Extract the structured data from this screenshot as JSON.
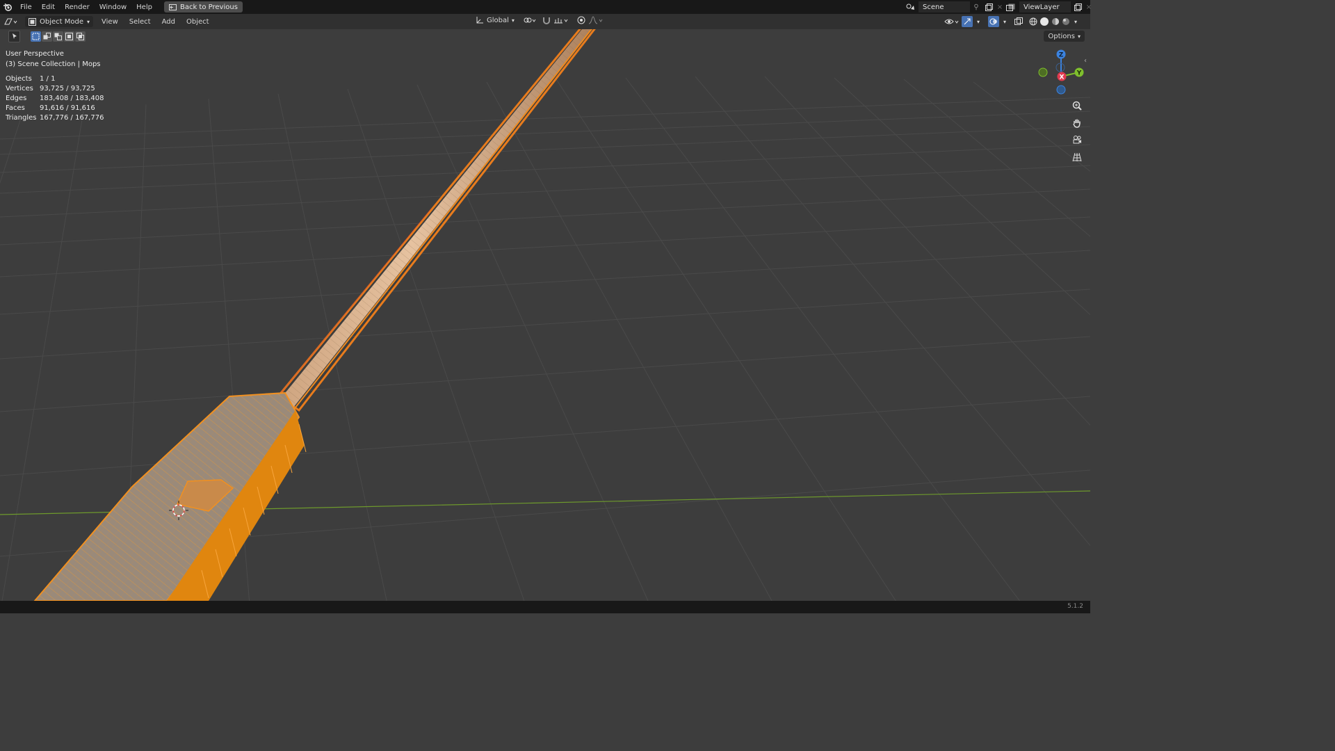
{
  "menu": {
    "file": "File",
    "edit": "Edit",
    "render": "Render",
    "window": "Window",
    "help": "Help",
    "back_to_previous": "Back to Previous"
  },
  "scene": {
    "name": "Scene"
  },
  "view_layer": {
    "name": "ViewLayer"
  },
  "viewport_header": {
    "mode": "Object Mode",
    "view": "View",
    "select": "Select",
    "add": "Add",
    "object": "Object",
    "orientation": "Global"
  },
  "options_label": "Options",
  "overlay": {
    "perspective": "User Perspective",
    "collection": "(3) Scene Collection | Mops"
  },
  "stats": [
    {
      "label": "Objects",
      "value": "1 / 1"
    },
    {
      "label": "Vertices",
      "value": "93,725 / 93,725"
    },
    {
      "label": "Edges",
      "value": "183,408 / 183,408"
    },
    {
      "label": "Faces",
      "value": "91,616 / 91,616"
    },
    {
      "label": "Triangles",
      "value": "167,776 / 167,776"
    }
  ],
  "gizmo": {
    "z": "Z",
    "x": "X",
    "y": "Y"
  },
  "version": "5.1.2",
  "colors": {
    "selection_orange": "#f2901f",
    "axis_x": "#e13a4f",
    "axis_y": "#7fbf2d",
    "axis_z": "#3b83e0",
    "active_tool": "#4772b3"
  }
}
